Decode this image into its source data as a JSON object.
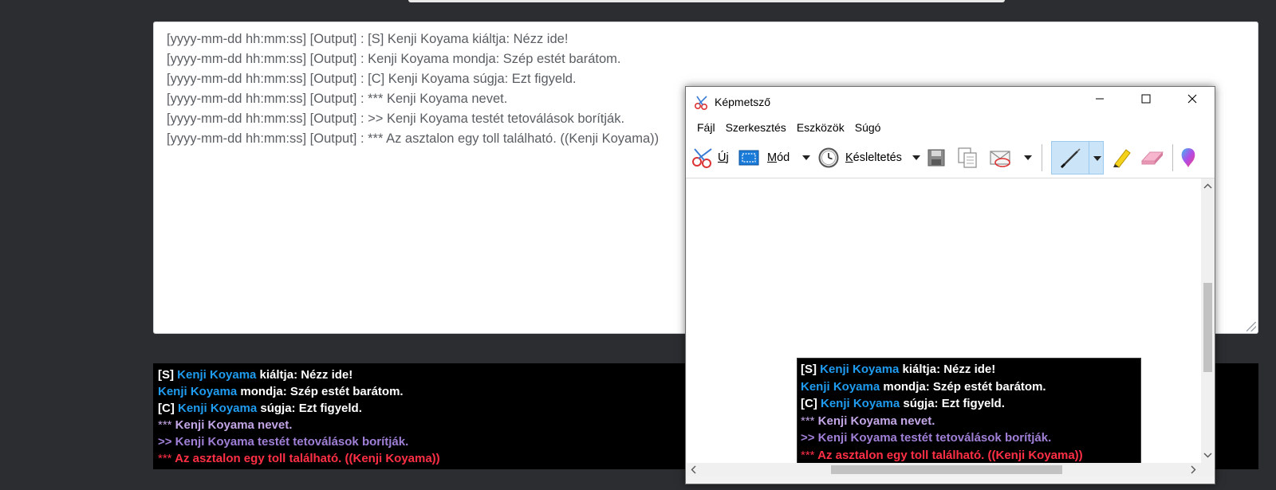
{
  "textarea": {
    "lines": [
      "[yyyy-mm-dd hh:mm:ss] [Output] : [S] Kenji Koyama kiáltja: Nézz ide!",
      "[yyyy-mm-dd hh:mm:ss] [Output] : Kenji Koyama mondja: Szép estét barátom.",
      "[yyyy-mm-dd hh:mm:ss] [Output] : [C] Kenji Koyama súgja: Ezt figyeld.",
      "[yyyy-mm-dd hh:mm:ss] [Output] : *** Kenji Koyama nevet.",
      "[yyyy-mm-dd hh:mm:ss] [Output] : >> Kenji Koyama testét tetoválások borítják.",
      "[yyyy-mm-dd hh:mm:ss] [Output] : *** Az asztalon egy toll található. ((Kenji Koyama))"
    ]
  },
  "chat": {
    "l1_prefix": "[S] ",
    "l1_name": "Kenji Koyama",
    "l1_rest": " kiáltja: Nézz ide!",
    "l2_name": "Kenji Koyama",
    "l2_rest": " mondja: Szép estét barátom.",
    "l3_prefix": "[C] ",
    "l3_name": "Kenji Koyama",
    "l3_rest": " súgja: Ezt figyeld.",
    "l4_stars": "***",
    "l4_rest": " Kenji Koyama nevet.",
    "l5": ">> Kenji Koyama testét tetoválások borítják.",
    "l6_stars": "***",
    "l6_rest": " Az asztalon egy toll található. ((Kenji Koyama))"
  },
  "snip": {
    "title": "Képmetsző",
    "menu": [
      "Fájl",
      "Szerkesztés",
      "Eszközök",
      "Súgó"
    ],
    "toolbar": {
      "new_label": "Új",
      "new_key": "Ú",
      "new_rest": "j",
      "mode_key": "M",
      "mode_rest": "ód",
      "delay_key": "K",
      "delay_rest": "ésleltetés"
    }
  },
  "colors": {
    "name_blue": "#1f9cf0",
    "emote_lavender": "#c3a6e6",
    "tattoo_purple": "#a07fd6",
    "item_red": "#ff2f45",
    "pen_active_bg": "#cce4f7"
  },
  "icons": [
    "scissors-icon",
    "rectangle-select-icon",
    "clock-icon",
    "save-icon",
    "copy-icon",
    "email-icon",
    "pen-icon",
    "highlighter-icon",
    "eraser-icon",
    "paint3d-icon",
    "minimize-icon",
    "maximize-icon",
    "close-icon"
  ]
}
